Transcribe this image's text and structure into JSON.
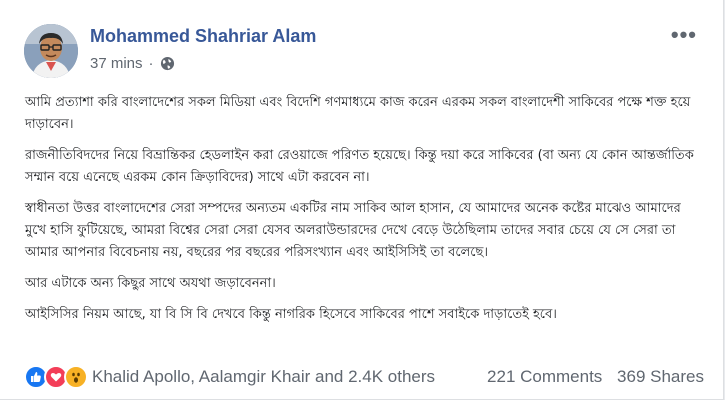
{
  "post": {
    "author": "Mohammed Shahriar Alam",
    "time": "37 mins",
    "time_separator": "·",
    "privacy_icon": "globe-icon",
    "menu_label": "•••",
    "paragraphs": [
      "আমি প্রত্যাশা করি বাংলাদেশের সকল মিডিয়া এবং বিদেশি গণমাধ্যমে কাজ করেন এরকম সকল বাংলাদেশী সাকিবের পক্ষে শক্ত হয়ে দাড়াবেন।",
      "রাজনীতিবিদদের নিয়ে বিভ্রান্তিকর হেডলাইন করা রেওয়াজে পরিণত হয়েছে। কিন্তু দয়া করে সাকিবের (বা অন্য যে কোন আন্তর্জাতিক সম্মান বয়ে এনেছে এরকম কোন ক্রিড়াবিদের) সাথে এটা করবেন না।",
      "স্বাধীনতা উত্তর বাংলাদেশের সেরা সম্পদের অন্যতম একটির নাম সাকিব আল হাসান, যে আমাদের অনেক কষ্টের মাঝেও আমাদের মুখে হাসি ফুটিয়েছে, আমরা বিশ্বের সেরা সেরা যেসব অলরাউন্ডারদের দেখে বেড়ে উঠেছিলাম তাদের সবার চেয়ে যে সে সেরা তা আমার আপনার বিবেচনায় নয়, বছরের পর বছরের পরিসংখ্যান এবং আইসিসিই তা বলেছে।",
      "আর এটাকে অন্য কিছুর সাথে অযথা জড়াবেননা।",
      "আইসিসির নিয়ম আছে, যা বি সি বি দেখবে কিন্তু নাগরিক হিসেবে সাকিবের পাশে সবাইকে দাড়াতেই হবে।"
    ]
  },
  "footer": {
    "reaction_icons": [
      "like-icon",
      "love-icon",
      "wow-icon"
    ],
    "reactors": "Khalid Apollo, Aalamgir Khair and 2.4K others",
    "comments": "221 Comments",
    "shares": "369 Shares"
  },
  "colors": {
    "author": "#385898",
    "meta": "#606770",
    "like": "#1877f2",
    "love": "#f33e58",
    "wow": "#f7b125"
  }
}
